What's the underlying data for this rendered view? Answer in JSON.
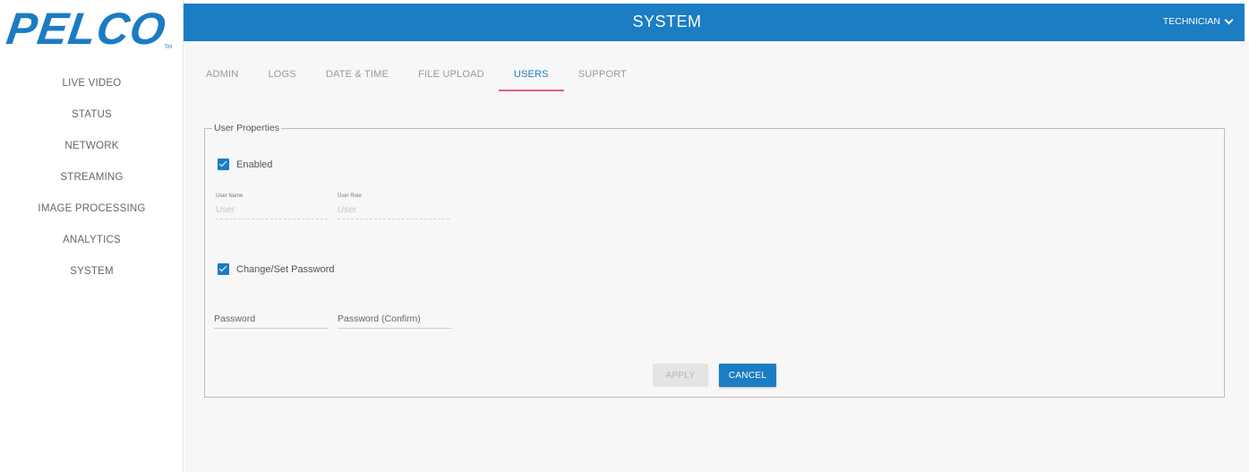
{
  "brand": {
    "logo_text": "PELCO",
    "logo_tm": "TM",
    "color": "#1b7dc4"
  },
  "sidebar": {
    "items": [
      {
        "label": "LIVE VIDEO"
      },
      {
        "label": "STATUS"
      },
      {
        "label": "NETWORK"
      },
      {
        "label": "STREAMING"
      },
      {
        "label": "IMAGE PROCESSING"
      },
      {
        "label": "ANALYTICS"
      },
      {
        "label": "SYSTEM"
      }
    ]
  },
  "header": {
    "title": "SYSTEM",
    "user_role": "TECHNICIAN",
    "user_menu_icon": "chevron-down-icon"
  },
  "tabs": [
    {
      "label": "ADMIN",
      "active": false
    },
    {
      "label": "LOGS",
      "active": false
    },
    {
      "label": "DATE & TIME",
      "active": false
    },
    {
      "label": "FILE UPLOAD",
      "active": false
    },
    {
      "label": "USERS",
      "active": true
    },
    {
      "label": "SUPPORT",
      "active": false
    }
  ],
  "user_properties": {
    "legend": "User Properties",
    "enabled": {
      "label": "Enabled",
      "checked": true
    },
    "user_name": {
      "label": "User Name",
      "placeholder": "User"
    },
    "user_role": {
      "label": "User Role",
      "placeholder": "User"
    },
    "change_password": {
      "label": "Change/Set Password",
      "checked": true
    },
    "password": {
      "placeholder": "Password"
    },
    "password_confirm": {
      "placeholder": "Password (Confirm)"
    },
    "apply_label": "APPLY",
    "cancel_label": "CANCEL"
  }
}
